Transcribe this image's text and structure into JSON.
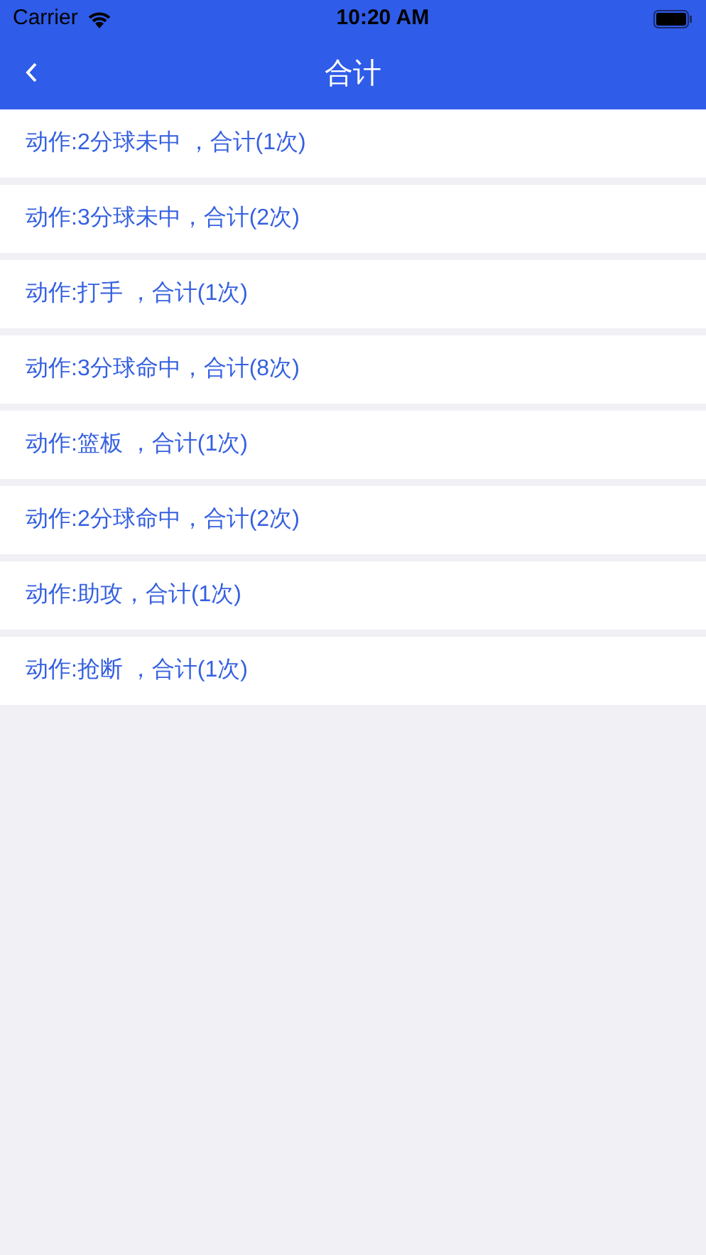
{
  "status_bar": {
    "carrier": "Carrier",
    "time": "10:20 AM"
  },
  "nav_bar": {
    "title": "合计"
  },
  "rows": [
    {
      "text": "动作:2分球未中 ，合计(1次)"
    },
    {
      "text": "动作:3分球未中，合计(2次)"
    },
    {
      "text": "动作:打手 ，合计(1次)"
    },
    {
      "text": "动作:3分球命中，合计(8次)"
    },
    {
      "text": "动作:篮板 ，合计(1次)"
    },
    {
      "text": "动作:2分球命中，合计(2次)"
    },
    {
      "text": "动作:助攻，合计(1次)"
    },
    {
      "text": "动作:抢断 ，合计(1次)"
    }
  ]
}
